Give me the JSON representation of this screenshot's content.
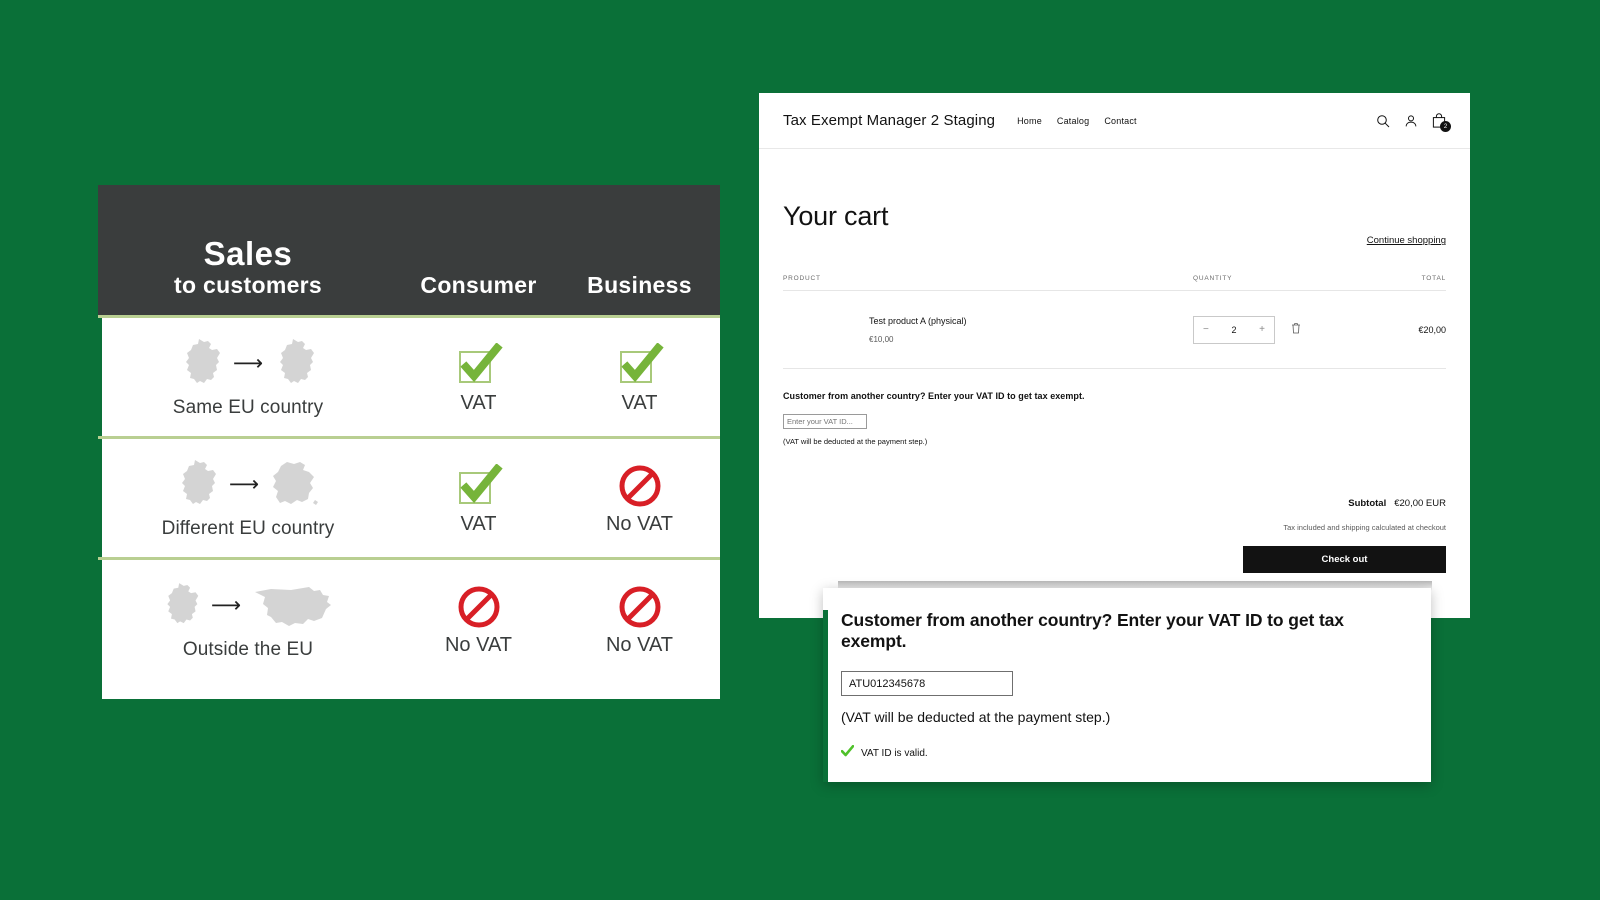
{
  "theme": {
    "page_background": "#0a7038",
    "header_dark": "#3a3d3d",
    "divider_green": "#b9cf92",
    "check_green": "#79b43c",
    "deny_red": "#d81f26",
    "accent_black": "#121212"
  },
  "infographic": {
    "header": {
      "title_line1": "Sales",
      "title_line2": "to customers",
      "col_consumer": "Consumer",
      "col_business": "Business"
    },
    "rows": [
      {
        "label": "Same EU country",
        "from_map": "germany-map-icon",
        "to_map": "germany-map-icon",
        "consumer": {
          "icon": "check-vat-icon",
          "text": "VAT"
        },
        "business": {
          "icon": "check-vat-icon",
          "text": "VAT"
        }
      },
      {
        "label": "Different EU country",
        "from_map": "germany-map-icon",
        "to_map": "france-map-icon",
        "consumer": {
          "icon": "check-vat-icon",
          "text": "VAT"
        },
        "business": {
          "icon": "no-vat-icon",
          "text": "No VAT"
        }
      },
      {
        "label": "Outside the EU",
        "from_map": "germany-map-icon",
        "to_map": "usa-map-icon",
        "consumer": {
          "icon": "no-vat-icon",
          "text": "No VAT"
        },
        "business": {
          "icon": "no-vat-icon",
          "text": "No VAT"
        }
      }
    ]
  },
  "store": {
    "header": {
      "logo": "Tax Exempt Manager 2 Staging",
      "nav": [
        {
          "label": "Home"
        },
        {
          "label": "Catalog"
        },
        {
          "label": "Contact"
        }
      ],
      "icons": {
        "search": "search-icon",
        "account": "account-icon",
        "cart": "cart-icon"
      },
      "cart_count": "2"
    },
    "cart": {
      "title": "Your cart",
      "continue_link": "Continue shopping",
      "columns": {
        "product": "PRODUCT",
        "quantity": "QUANTITY",
        "total": "TOTAL"
      },
      "items": [
        {
          "name": "Test product A (physical)",
          "price": "€10,00",
          "quantity": "2",
          "decrease_label": "−",
          "increase_label": "+",
          "remove_icon": "trash-icon",
          "total": "€20,00"
        }
      ],
      "vat": {
        "prompt": "Customer from another country? Enter your VAT ID to get tax exempt.",
        "input_value": "",
        "input_placeholder": "Enter your VAT ID...",
        "note": "(VAT will be deducted at the payment step.)"
      },
      "summary": {
        "subtotal_label": "Subtotal",
        "subtotal_value": "€20,00 EUR",
        "tax_note": "Tax included and shipping calculated at checkout",
        "checkout_label": "Check out"
      }
    }
  },
  "inset": {
    "prompt": "Customer from another country? Enter your VAT ID to get tax exempt.",
    "input_value": "ATU012345678",
    "input_placeholder": "Enter your VAT ID...",
    "note": "(VAT will be deducted at the payment step.)",
    "validation_icon": "check-icon",
    "validation_text": "VAT ID is valid."
  }
}
